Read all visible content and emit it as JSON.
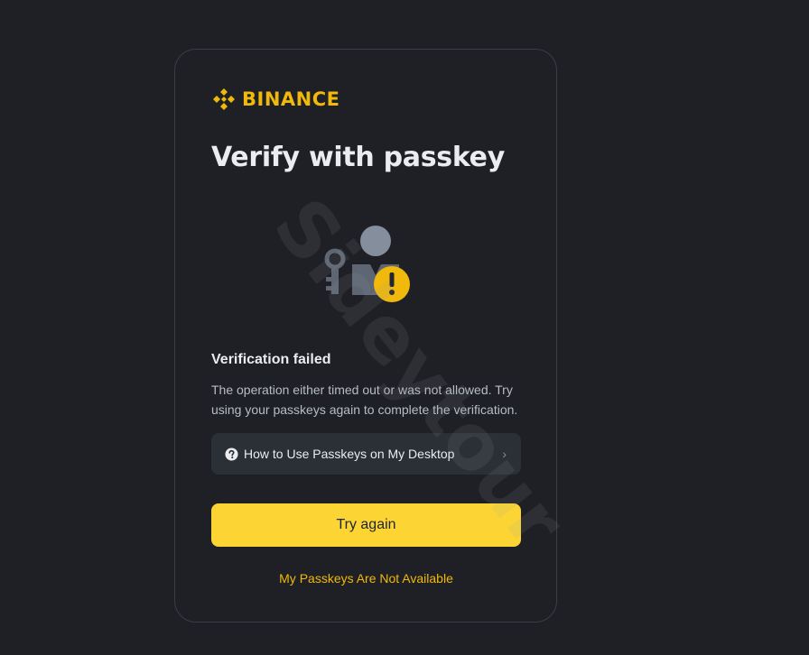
{
  "brand": {
    "name": "BINANCE",
    "logo_icon": "binance-diamond-icon",
    "color": "#f0b90b"
  },
  "page": {
    "title": "Verify with passkey"
  },
  "illustration": {
    "icon": "passkey-warning-icon",
    "warning_color": "#f0b90b"
  },
  "status": {
    "title": "Verification failed",
    "message": "The operation either timed out or was not allowed. Try using your passkeys again to complete the verification."
  },
  "help": {
    "icon": "question-circle-icon",
    "label": "How to Use Passkeys on My Desktop",
    "chevron": "›"
  },
  "actions": {
    "try_again_label": "Try again",
    "not_available_label": "My Passkeys Are Not Available",
    "primary_color": "#fcd535"
  },
  "watermark": {
    "text": "Sideytour"
  }
}
